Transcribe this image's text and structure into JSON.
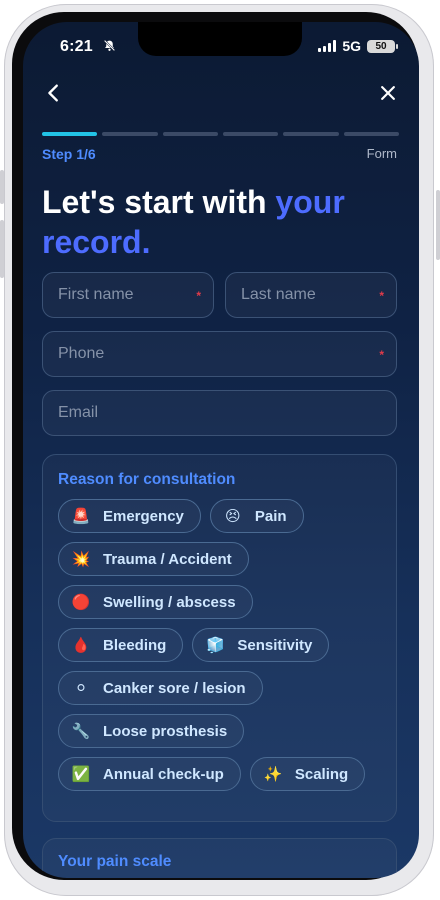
{
  "status": {
    "time": "6:21",
    "network": "5G",
    "battery": "50"
  },
  "nav": {
    "back_icon": "chevron-left-icon",
    "close_icon": "close-icon"
  },
  "progress": {
    "current_step": 1,
    "total_steps": 6,
    "step_label": "Step 1/6",
    "right_label": "Form"
  },
  "headline": {
    "text": "Let's start with ",
    "accent": "your record."
  },
  "form": {
    "first_name": {
      "placeholder": "First name",
      "required_mark": "*"
    },
    "last_name": {
      "placeholder": "Last name",
      "required_mark": "*"
    },
    "phone": {
      "placeholder": "Phone",
      "required_mark": "*"
    },
    "email": {
      "placeholder": "Email"
    }
  },
  "reason": {
    "title": "Reason for consultation",
    "rows": [
      [
        {
          "emoji": "🚨",
          "label": "Emergency"
        },
        {
          "emoji": "😣",
          "label": "Pain"
        }
      ],
      [
        {
          "emoji": "💥",
          "label": "Trauma / Accident"
        }
      ],
      [
        {
          "emoji": "🔴",
          "label": "Swelling / abscess"
        }
      ],
      [
        {
          "emoji": "🩸",
          "label": "Bleeding"
        },
        {
          "emoji": "🧊",
          "label": "Sensitivity"
        }
      ],
      [
        {
          "emoji": "⚪",
          "label": "Canker sore / lesion"
        }
      ],
      [
        {
          "emoji": "🔧",
          "label": "Loose prosthesis"
        }
      ],
      [
        {
          "emoji": "✅",
          "label": "Annual check-up"
        },
        {
          "emoji": "✨",
          "label": "Scaling"
        }
      ]
    ]
  },
  "pain_scale": {
    "title": "Your pain scale"
  },
  "colors": {
    "accent": "#4d6cff",
    "progress_active": "#22c3e6",
    "required": "#e03b4a"
  }
}
